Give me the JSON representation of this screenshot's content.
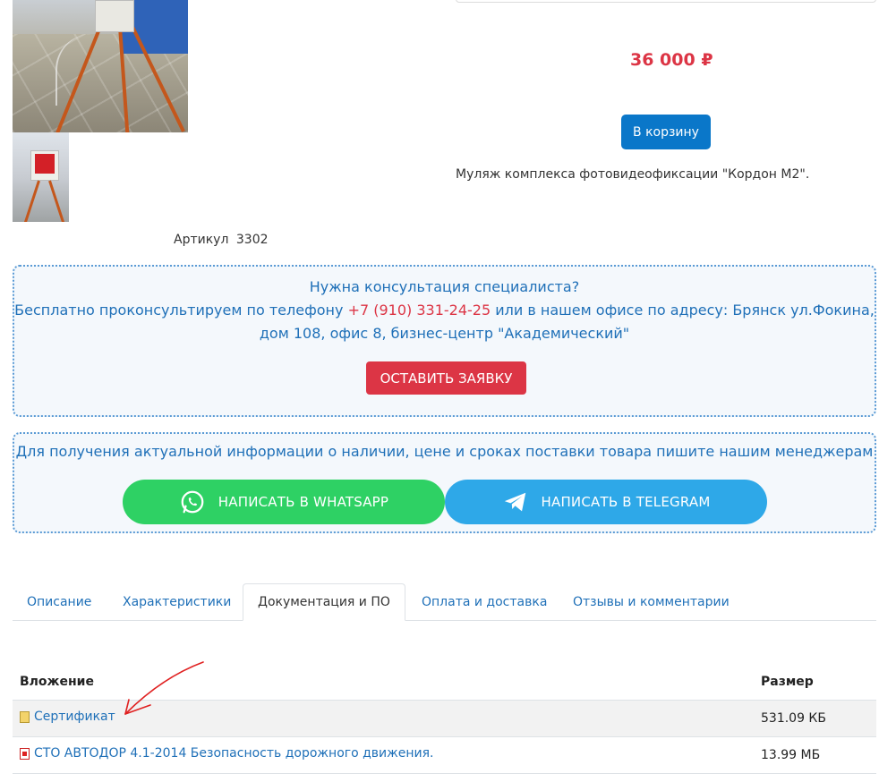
{
  "product": {
    "article_label": "Артикул",
    "article_value": "3302",
    "price": "36 000 ₽",
    "cart_button": "В корзину",
    "description": "Муляж комплекса фотовидеофиксации \"Кордон М2\"."
  },
  "consultation": {
    "title": "Нужна консультация специалиста?",
    "text_before_phone": "Бесплатно проконсультируем по телефону ",
    "phone": "+7 (910) 331-24-25",
    "text_after_phone": " или в нашем офисе по адресу: Брянск ул.Фокина, дом 108, офис 8, бизнес-центр \"Академический\"",
    "button": "ОСТАВИТЬ ЗАЯВКУ"
  },
  "messengers": {
    "title": "Для получения актуальной информации о наличии, цене и сроках поставки товара пишите нашим менеджерам",
    "whatsapp_button": "НАПИСАТЬ В WHATSAPP",
    "telegram_button": "НАПИСАТЬ В TELEGRAM",
    "whatsapp_color": "#2ed164",
    "telegram_color": "#2ea8e8"
  },
  "tabs": [
    {
      "label": "Описание",
      "active": false
    },
    {
      "label": "Характеристики",
      "active": false
    },
    {
      "label": "Документация и ПО",
      "active": true
    },
    {
      "label": "Оплата и доставка",
      "active": false
    },
    {
      "label": "Отзывы и комментарии",
      "active": false
    }
  ],
  "attachments": {
    "header_name": "Вложение",
    "header_size": "Размер",
    "rows": [
      {
        "name": "Сертификат",
        "size": "531.09 КБ",
        "icon": "image-file-icon"
      },
      {
        "name": "СТО АВТОДОР 4.1-2014 Безопасность дорожного движения.",
        "size": "13.99 МБ",
        "icon": "pdf-file-icon"
      }
    ]
  },
  "colors": {
    "accent_blue": "#1f70b8",
    "price_red": "#dc3545",
    "cart_blue": "#0a77c9",
    "annotation_arrow": "#e02020"
  }
}
